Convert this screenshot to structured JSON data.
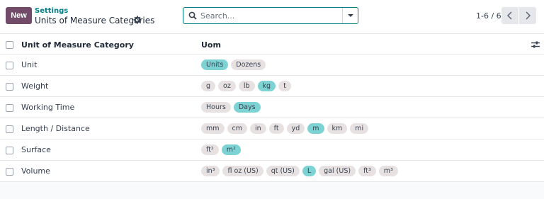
{
  "header": {
    "new_label": "New",
    "breadcrumb": "Settings",
    "title": "Units of Measure Categories"
  },
  "search": {
    "placeholder": "Search..."
  },
  "pager": {
    "value": "1-6 / 6"
  },
  "table": {
    "col_category": "Unit of Measure Category",
    "col_uom": "Uom",
    "rows": [
      {
        "name": "Unit",
        "tags": [
          {
            "label": "Units",
            "reference": true
          },
          {
            "label": "Dozens",
            "reference": false
          }
        ]
      },
      {
        "name": "Weight",
        "tags": [
          {
            "label": "g",
            "reference": false
          },
          {
            "label": "oz",
            "reference": false
          },
          {
            "label": "lb",
            "reference": false
          },
          {
            "label": "kg",
            "reference": true
          },
          {
            "label": "t",
            "reference": false
          }
        ]
      },
      {
        "name": "Working Time",
        "tags": [
          {
            "label": "Hours",
            "reference": false
          },
          {
            "label": "Days",
            "reference": true
          }
        ]
      },
      {
        "name": "Length / Distance",
        "tags": [
          {
            "label": "mm",
            "reference": false
          },
          {
            "label": "cm",
            "reference": false
          },
          {
            "label": "in",
            "reference": false
          },
          {
            "label": "ft",
            "reference": false
          },
          {
            "label": "yd",
            "reference": false
          },
          {
            "label": "m",
            "reference": true
          },
          {
            "label": "km",
            "reference": false
          },
          {
            "label": "mi",
            "reference": false
          }
        ]
      },
      {
        "name": "Surface",
        "tags": [
          {
            "label": "ft²",
            "reference": false
          },
          {
            "label": "m²",
            "reference": true
          }
        ]
      },
      {
        "name": "Volume",
        "tags": [
          {
            "label": "in³",
            "reference": false
          },
          {
            "label": "fl oz (US)",
            "reference": false
          },
          {
            "label": "qt (US)",
            "reference": false
          },
          {
            "label": "L",
            "reference": true
          },
          {
            "label": "gal (US)",
            "reference": false
          },
          {
            "label": "ft³",
            "reference": false
          },
          {
            "label": "m³",
            "reference": false
          }
        ]
      }
    ]
  },
  "colors": {
    "brand": "#714b67",
    "accent": "#017e84",
    "reference_tag": "#7dd3d3",
    "tag": "#e7e2e1"
  }
}
